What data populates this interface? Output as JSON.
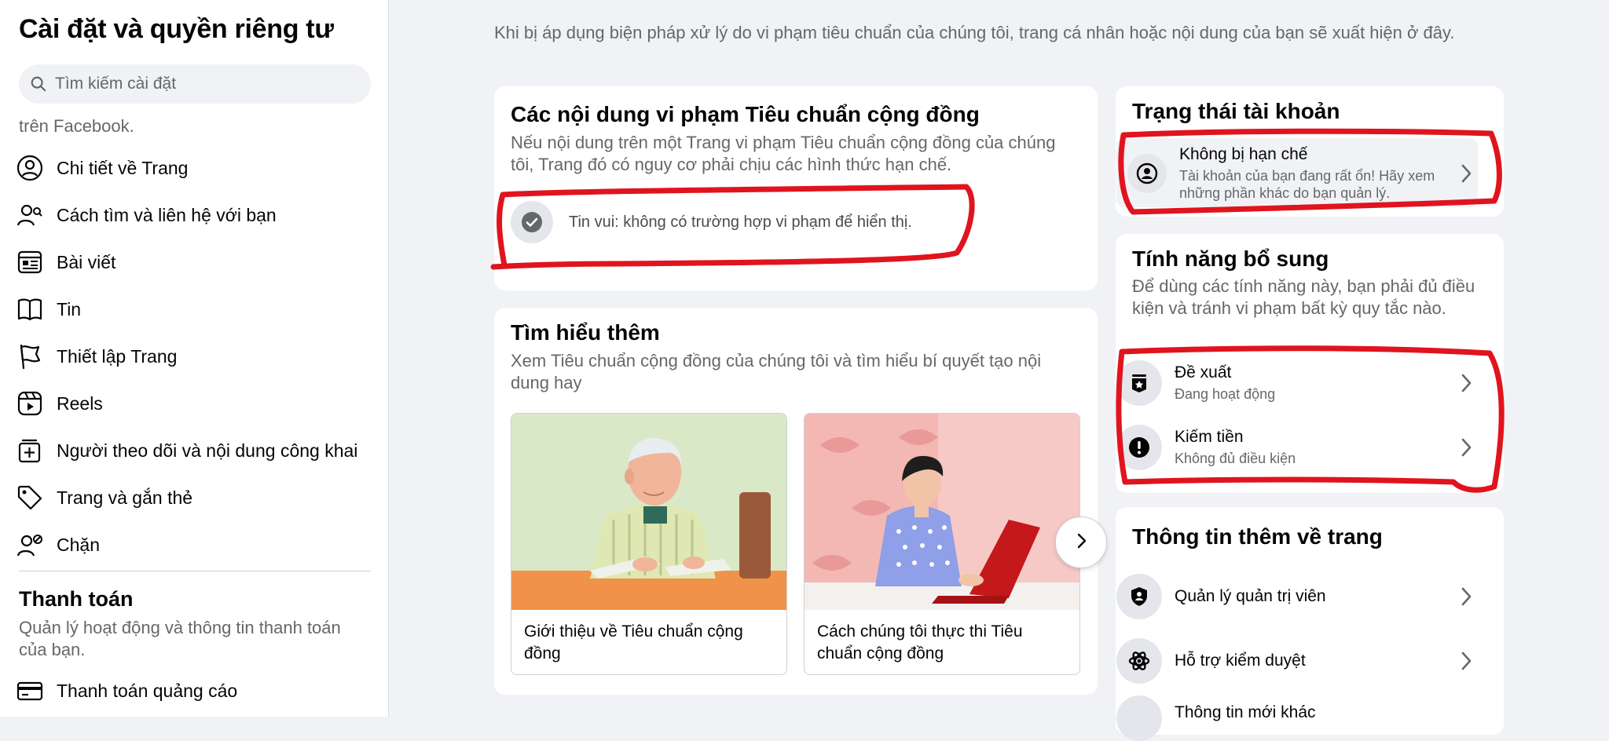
{
  "sidebar": {
    "title": "Cài đặt và quyền riêng tư",
    "search_placeholder": "Tìm kiếm cài đặt",
    "cut_text": "trên Facebook.",
    "items": [
      {
        "label": "Chi tiết về Trang",
        "icon": "person-circle-icon"
      },
      {
        "label": "Cách tìm và liên hệ với bạn",
        "icon": "person-search-icon"
      },
      {
        "label": "Bài viết",
        "icon": "post-icon"
      },
      {
        "label": "Tin",
        "icon": "book-icon"
      },
      {
        "label": "Thiết lập Trang",
        "icon": "flag-icon"
      },
      {
        "label": "Reels",
        "icon": "reels-icon"
      },
      {
        "label": "Người theo dõi và nội dung công khai",
        "icon": "followers-icon"
      },
      {
        "label": "Trang và gắn thẻ",
        "icon": "tag-icon"
      },
      {
        "label": "Chặn",
        "icon": "block-user-icon"
      }
    ],
    "payments": {
      "title": "Thanh toán",
      "description": "Quản lý hoạt động và thông tin thanh toán của bạn.",
      "item": {
        "label": "Thanh toán quảng cáo",
        "icon": "credit-card-icon"
      }
    }
  },
  "main": {
    "intro": "Khi bị áp dụng biện pháp xử lý do vi phạm tiêu chuẩn của chúng tôi, trang cá nhân hoặc nội dung của bạn sẽ xuất hiện ở đây.",
    "violations": {
      "title": "Các nội dung vi phạm Tiêu chuẩn cộng đồng",
      "description": "Nếu nội dung trên một Trang vi phạm Tiêu chuẩn cộng đồng của chúng tôi, Trang đó có nguy cơ phải chịu các hình thức hạn chế.",
      "good_news": "Tin vui: không có trường hợp vi phạm để hiển thị."
    },
    "learn_more": {
      "title": "Tìm hiểu thêm",
      "description": "Xem Tiêu chuẩn cộng đồng của chúng tôi và tìm hiểu bí quyết tạo nội dung hay",
      "cards": [
        {
          "caption": "Giới thiệu về Tiêu chuẩn cộng đồng"
        },
        {
          "caption": "Cách chúng tôi thực thi Tiêu chuẩn cộng đồng"
        }
      ]
    }
  },
  "right": {
    "account_status": {
      "title": "Trạng thái tài khoản",
      "row": {
        "title": "Không bị hạn chế",
        "subtitle": "Tài khoản của bạn đang rất ổn! Hãy xem những phần khác do bạn quản lý."
      }
    },
    "extra_features": {
      "title": "Tính năng bổ sung",
      "description": "Để dùng các tính năng này, bạn phải đủ điều kiện và tránh vi phạm bất kỳ quy tắc nào.",
      "rows": [
        {
          "title": "Đề xuất",
          "subtitle": "Đang hoạt động"
        },
        {
          "title": "Kiếm tiền",
          "subtitle": "Không đủ điều kiện"
        }
      ]
    },
    "page_info": {
      "title": "Thông tin thêm về trang",
      "rows": [
        {
          "title": "Quản lý quản trị viên"
        },
        {
          "title": "Hỗ trợ kiểm duyệt"
        },
        {
          "title": "Thông tin mới khác"
        }
      ]
    }
  },
  "colors": {
    "background": "#f0f2f5",
    "card": "#ffffff",
    "secondary_text": "#65676b",
    "marker_red": "#e0141e"
  }
}
